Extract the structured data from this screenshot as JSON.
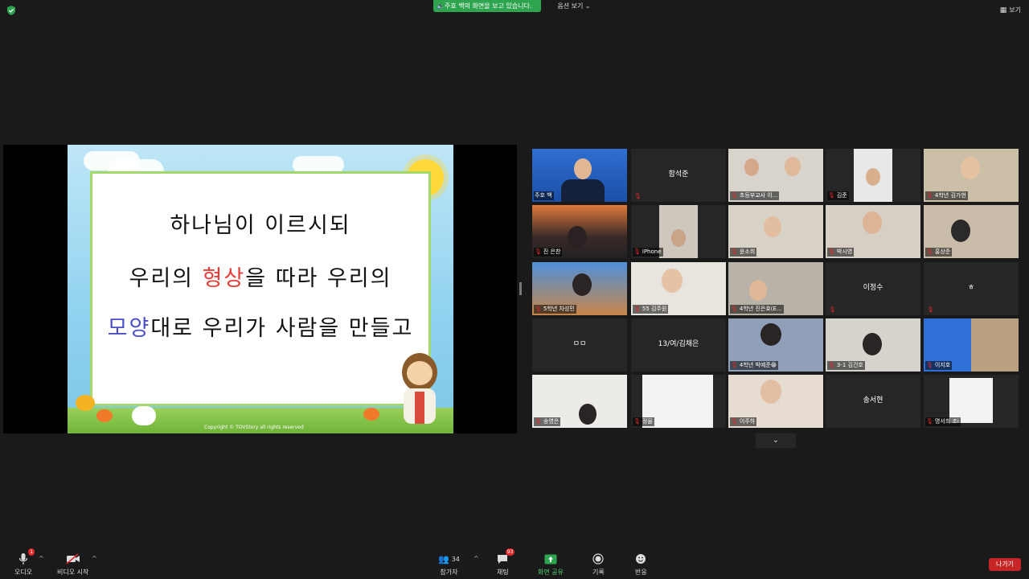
{
  "top": {
    "sharing_banner": "주호 백의 화면을 보고 있습니다.",
    "view_options": "옵션 보기",
    "view_toggle": "보기"
  },
  "slide": {
    "line1": "하나님이 이르시되",
    "line2_a": "우리의 ",
    "line2_red": "형상",
    "line2_b": "을 따라 우리의",
    "line3_blue": "모양",
    "line3_b": "대로 우리가 사람을 만들고",
    "copyright": "Copyright © TOVStory all rights reserved"
  },
  "gallery": {
    "tiles": [
      {
        "name": "주호 백",
        "mode": "video"
      },
      {
        "name": "함석준",
        "mode": "name"
      },
      {
        "name": "초등부교사 이...",
        "mode": "video"
      },
      {
        "name": "김준",
        "mode": "video"
      },
      {
        "name": "4학년 김가현",
        "mode": "video"
      },
      {
        "name": "진 은찬",
        "mode": "video"
      },
      {
        "name": "iPhone",
        "mode": "video"
      },
      {
        "name": "윤소희",
        "mode": "video"
      },
      {
        "name": "박시영",
        "mode": "video"
      },
      {
        "name": "홍상준",
        "mode": "video"
      },
      {
        "name": "5학년 차성민",
        "mode": "video"
      },
      {
        "name": "55 김주원",
        "mode": "video"
      },
      {
        "name": "4학년 진은효(E...",
        "mode": "video"
      },
      {
        "name": "이정수",
        "mode": "name"
      },
      {
        "name": "ㅎ",
        "mode": "name"
      },
      {
        "name": "ㅁㅁ",
        "mode": "name"
      },
      {
        "name": "13/여/김채은",
        "mode": "name"
      },
      {
        "name": "4학년 박예준😁",
        "mode": "video"
      },
      {
        "name": "3-1 김건호",
        "mode": "video"
      },
      {
        "name": "이지호",
        "mode": "video"
      },
      {
        "name": "송영은",
        "mode": "video"
      },
      {
        "name": "정율",
        "mode": "video"
      },
      {
        "name": "이주하",
        "mode": "video"
      },
      {
        "name": "송서현",
        "mode": "name"
      },
      {
        "name": "명서희 조i",
        "mode": "video"
      }
    ]
  },
  "toolbar": {
    "audio": "오디오",
    "audio_badge": "1",
    "video": "비디오 시작",
    "participants": "참가자",
    "participants_count": "34",
    "chat": "채팅",
    "chat_badge": "93",
    "share": "화면 공유",
    "record": "기록",
    "reactions": "반응",
    "leave": "나가기"
  },
  "colors": {
    "banner_green": "#2ea44f",
    "leave_red": "#c62626",
    "active_speaker": "#e8e23a"
  }
}
